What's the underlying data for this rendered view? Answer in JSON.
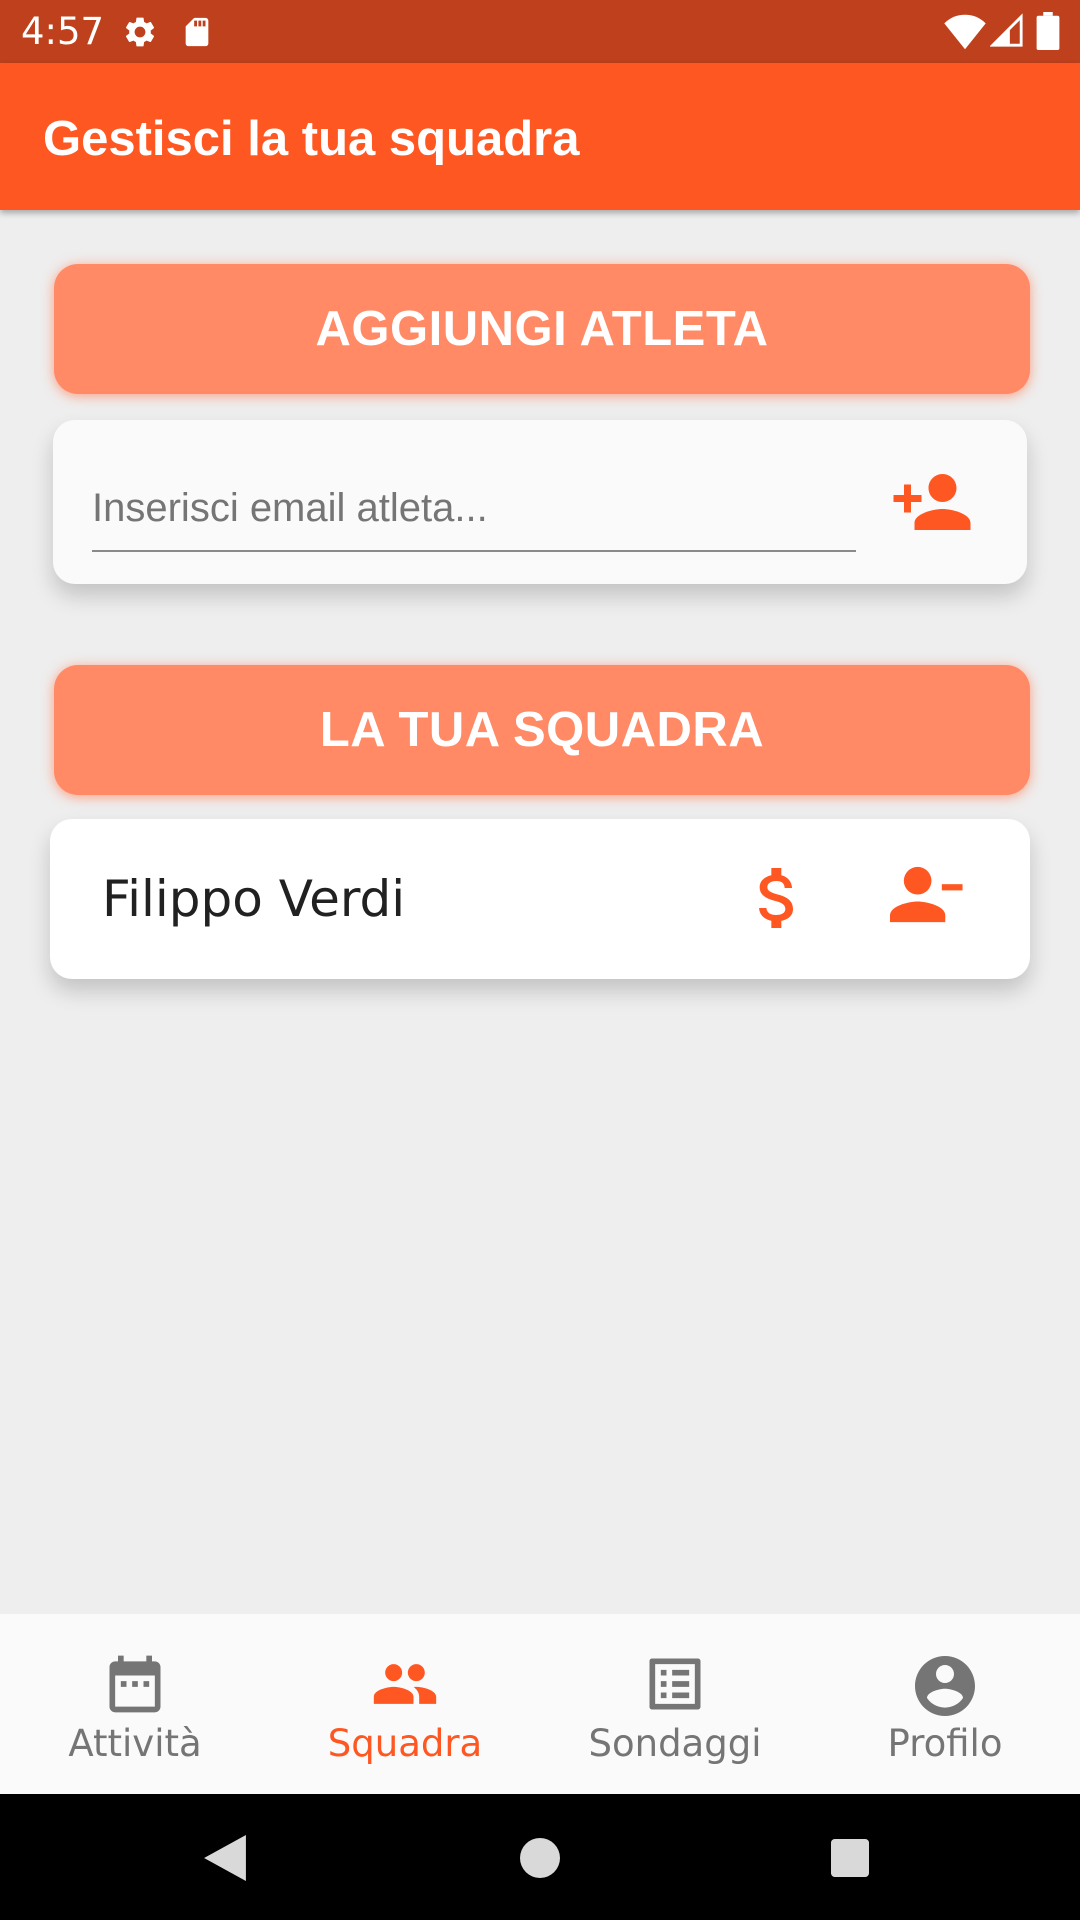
{
  "status_bar": {
    "time": "4:57",
    "icons": [
      "settings-icon",
      "sd-card-icon",
      "wifi-icon",
      "signal-icon",
      "battery-icon"
    ]
  },
  "app_bar": {
    "title": "Gestisci la tua squadra"
  },
  "add_athlete": {
    "header": "AGGIUNGI ATLETA",
    "email_placeholder": "Inserisci email atleta...",
    "email_value": "",
    "add_icon": "person-add-icon"
  },
  "team": {
    "header": "LA TUA SQUADRA",
    "members": [
      {
        "name": "Filippo Verdi",
        "payment_icon": "dollar-icon",
        "remove_icon": "person-remove-icon"
      }
    ]
  },
  "bottom_nav": {
    "items": [
      {
        "label": "Attività",
        "icon": "calendar-icon",
        "active": false
      },
      {
        "label": "Squadra",
        "icon": "group-icon",
        "active": true
      },
      {
        "label": "Sondaggi",
        "icon": "poll-list-icon",
        "active": false
      },
      {
        "label": "Profilo",
        "icon": "account-circle-icon",
        "active": false
      }
    ]
  },
  "colors": {
    "primary": "#ff5722",
    "primary_dark": "#bf401c",
    "accent_light": "#ff8a65",
    "background": "#eeeeee"
  }
}
